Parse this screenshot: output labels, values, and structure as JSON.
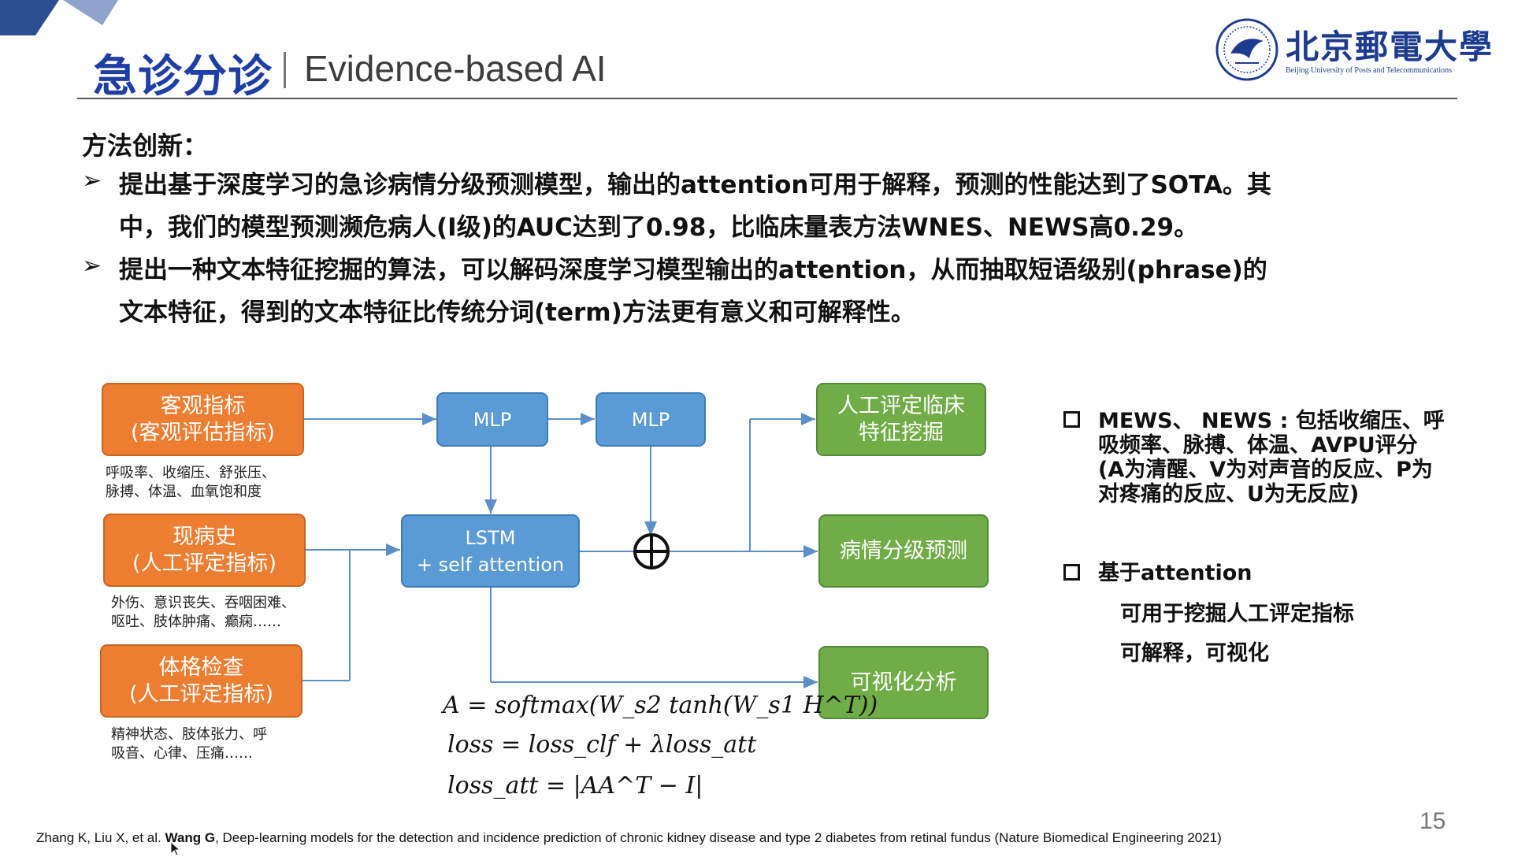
{
  "header": {
    "title_zh": "急诊分诊",
    "title_en": "Evidence-based AI"
  },
  "logo": {
    "name": "北京郵電大學",
    "subtitle": "Beijing University of Posts and Telecommunications"
  },
  "method": {
    "heading": "方法创新：",
    "bullets": [
      {
        "line1": "提出基于深度学习的急诊病情分级预测模型，输出的attention可用于解释，预测的性能达到了SOTA。其",
        "line2": "中，我们的模型预测濒危病人(I级)的AUC达到了0.98，比临床量表方法WNES、NEWS高0.29。"
      },
      {
        "line1": "提出一种文本特征挖掘的算法，可以解码深度学习模型输出的attention，从而抽取短语级别(phrase)的",
        "line2": "文本特征，得到的文本特征比传统分词(term)方法更有意义和可解释性。"
      }
    ]
  },
  "diagram": {
    "inputs": [
      {
        "line1": "客观指标",
        "line2": "(客观评估指标)",
        "note1": "呼吸率、收缩压、舒张压、",
        "note2": "脉搏、体温、血氧饱和度"
      },
      {
        "line1": "现病史",
        "line2": "(人工评定指标)",
        "note1": "外伤、意识丧失、吞咽困难、",
        "note2": "呕吐、肢体肿痛、癫痫……"
      },
      {
        "line1": "体格检查",
        "line2": "(人工评定指标)",
        "note1": "精神状态、肢体张力、呼",
        "note2": "吸音、心律、压痛……"
      }
    ],
    "mlp1": "MLP",
    "mlp2": "MLP",
    "lstm_line1": "LSTM",
    "lstm_line2": "+ self attention",
    "outputs": [
      {
        "line1": "人工评定临床",
        "line2": "特征挖掘"
      },
      {
        "line1": "病情分级预测",
        "line2": ""
      },
      {
        "line1": "可视化分析",
        "line2": ""
      }
    ]
  },
  "formulas": {
    "f1": "A = softmax(W_s2 tanh(W_s1 H^T))",
    "f2": "loss = loss_clf + λloss_att",
    "f3": "loss_att = |AA^T − I|"
  },
  "side_notes": {
    "item1_line1": "MEWS、 NEWS : 包括收缩压、呼",
    "item1_line2": "吸频率、脉搏、体温、AVPU评分",
    "item1_line3": "(A为清醒、V为对声音的反应、P为",
    "item1_line4": "对疼痛的反应、U为无反应)",
    "item2_title": "基于attention",
    "item2_sub1": "可用于挖掘人工评定指标",
    "item2_sub2": "可解释，可视化"
  },
  "citation": {
    "before": "Zhang K, Liu X, et al. ",
    "bold": "Wang G",
    "after": ", Deep-learning models for the detection and incidence prediction of chronic kidney disease and type 2 diabetes from retinal fundus (Nature Biomedical Engineering 2021)"
  },
  "page_number": "15",
  "colors": {
    "title_blue": "#1f3fa6",
    "orange": "#ed7d31",
    "blue": "#5b9bd5",
    "green": "#70ad47"
  }
}
